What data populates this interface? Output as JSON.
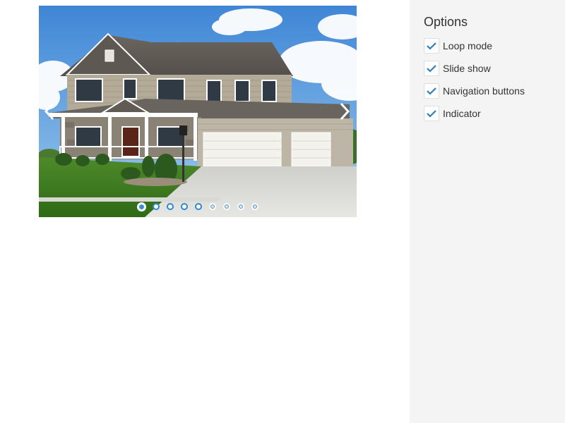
{
  "gallery": {
    "image_description_icon": "house-photo",
    "prev_icon": "chevron-left-icon",
    "next_icon": "chevron-right-icon",
    "indicator_count": 9,
    "selected_index": 0,
    "accent_color": "#3b8fd1"
  },
  "options": {
    "title": "Options",
    "items": [
      {
        "label": "Loop mode",
        "checked": true
      },
      {
        "label": "Slide show",
        "checked": true
      },
      {
        "label": "Navigation buttons",
        "checked": true
      },
      {
        "label": "Indicator",
        "checked": true
      }
    ],
    "check_color": "#2f7fbd"
  }
}
